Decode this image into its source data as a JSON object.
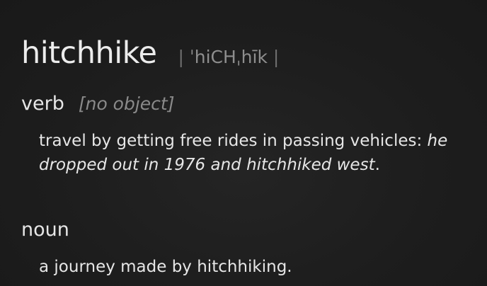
{
  "entry": {
    "headword": "hitchhike",
    "pronunciation": {
      "open_bar": "|",
      "text": "ˈhiCHˌhīk",
      "close_bar": "|"
    }
  },
  "senses": {
    "verb": {
      "part_of_speech": "verb",
      "grammar": "[no object]",
      "definition": "travel by getting free rides in passing vehicles:",
      "example": "he dropped out in 1976 and hitchhiked west",
      "example_end": "."
    },
    "noun": {
      "part_of_speech": "noun",
      "definition": "a journey made by hitchhiking."
    }
  }
}
